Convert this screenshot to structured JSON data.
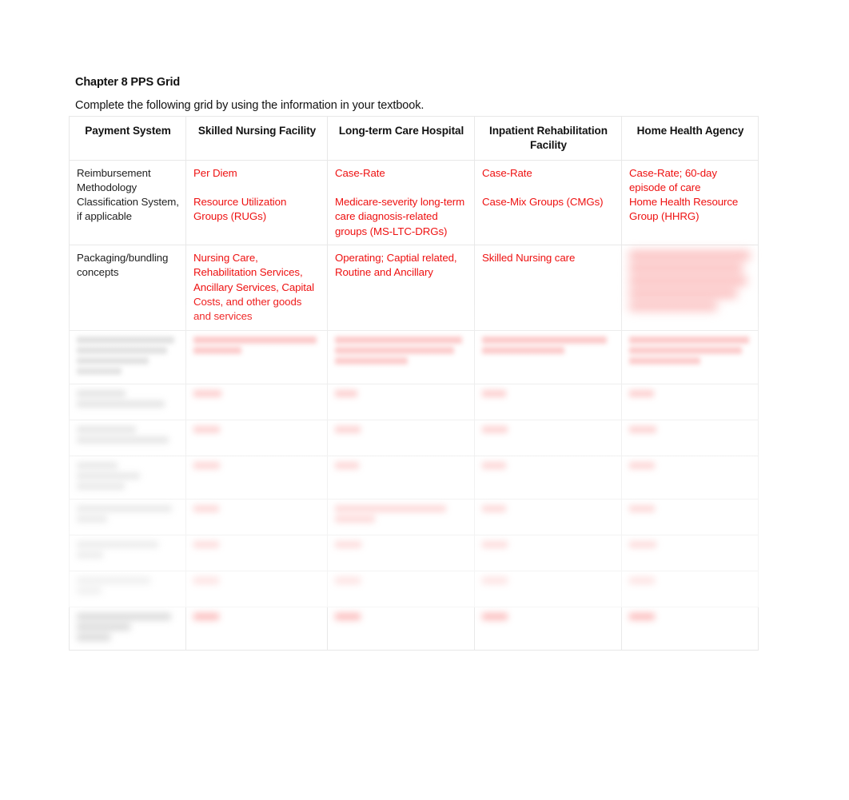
{
  "document": {
    "title": "Chapter 8 PPS Grid",
    "instruction": "Complete the following grid by using the information in your textbook."
  },
  "theme": {
    "page_background": "#ffffff",
    "body_text_color": "#1a1a1a",
    "answer_text_color": "#ee1111",
    "grid_line_color": "#e8e8e8"
  },
  "grid": {
    "columns": [
      "Payment System",
      "Skilled Nursing Facility",
      "Long-term Care Hospital",
      "Inpatient Rehabilitation Facility",
      "Home Health Agency"
    ],
    "rows": [
      {
        "label": "Reimbursement Methodology Classification System, if applicable",
        "legible": true,
        "cells": [
          {
            "lines": [
              "Per Diem",
              "",
              "Resource Utilization Groups (RUGs)"
            ]
          },
          {
            "lines": [
              "Case-Rate",
              "",
              "Medicare-severity long-term care diagnosis-related groups (MS-LTC-DRGs)"
            ]
          },
          {
            "lines": [
              "Case-Rate",
              "",
              "Case-Mix Groups (CMGs)"
            ]
          },
          {
            "lines": [
              "Case-Rate; 60-day episode of care",
              "Home Health Resource Group (HHRG)"
            ]
          }
        ]
      },
      {
        "label": "Packaging/bundling concepts",
        "legible": true,
        "cells": [
          {
            "lines": [
              "Nursing Care, Rehabilitation Services, Ancillary Services, Capital Costs, and other goods and services"
            ]
          },
          {
            "lines": [
              "Operating; Captial related, Routine and Ancillary"
            ]
          },
          {
            "lines": [
              "Skilled Nursing care"
            ]
          },
          {
            "lines": [],
            "illegible": true,
            "note": "content blurred beyond recognition in source image"
          }
        ]
      },
      {
        "label": "",
        "legible": false,
        "blur_level": 1,
        "label_bars": 4,
        "answer_bars": [
          2,
          3,
          2,
          3
        ]
      },
      {
        "label": "",
        "legible": false,
        "blur_level": 2,
        "label_bars": 2,
        "answer_bars": [
          1,
          1,
          1,
          1
        ]
      },
      {
        "label": "",
        "legible": false,
        "blur_level": 2,
        "label_bars": 2,
        "answer_bars": [
          1,
          1,
          1,
          1
        ]
      },
      {
        "label": "",
        "legible": false,
        "blur_level": 3,
        "label_bars": 3,
        "answer_bars": [
          1,
          1,
          1,
          1
        ]
      },
      {
        "label": "",
        "legible": false,
        "blur_level": 3,
        "label_bars": 2,
        "answer_bars": [
          1,
          2,
          1,
          1
        ]
      },
      {
        "label": "",
        "legible": false,
        "blur_level": 3,
        "label_bars": 2,
        "answer_bars": [
          1,
          1,
          1,
          1
        ]
      },
      {
        "label": "",
        "legible": false,
        "blur_level": 4,
        "label_bars": 2,
        "answer_bars": [
          1,
          1,
          1,
          1
        ]
      },
      {
        "label": "",
        "legible": false,
        "blur_level": 4,
        "label_bars": 3,
        "answer_bars": [
          1,
          1,
          1,
          1
        ]
      }
    ]
  }
}
